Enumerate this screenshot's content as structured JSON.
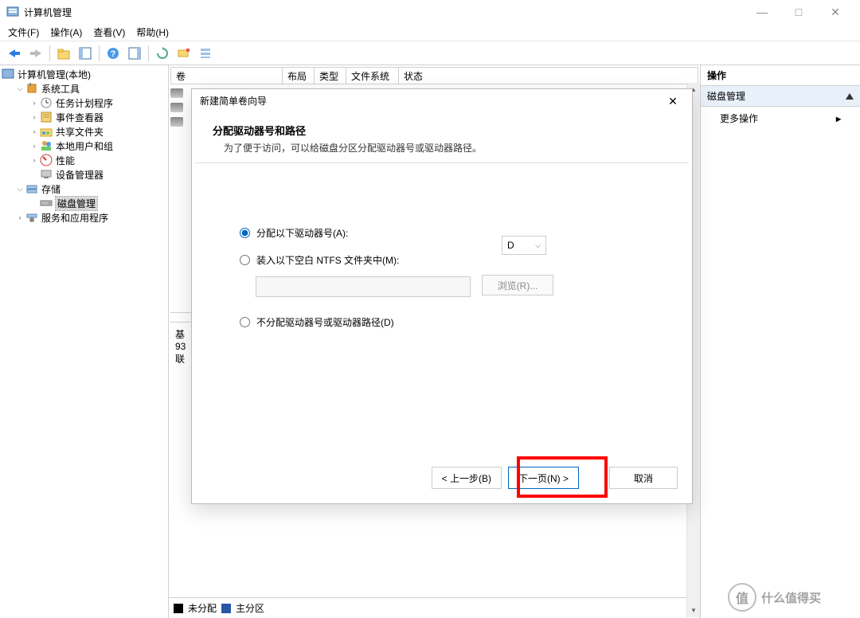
{
  "window": {
    "title": "计算机管理"
  },
  "win_controls": {
    "min": "—",
    "max": "□",
    "close": "✕"
  },
  "menu": {
    "file": "文件(F)",
    "action": "操作(A)",
    "view": "查看(V)",
    "help": "帮助(H)"
  },
  "tree": {
    "root": "计算机管理(本地)",
    "system_tools": "系统工具",
    "task_scheduler": "任务计划程序",
    "event_viewer": "事件查看器",
    "shared_folders": "共享文件夹",
    "local_users": "本地用户和组",
    "performance": "性能",
    "device_manager": "设备管理器",
    "storage": "存储",
    "disk_management": "磁盘管理",
    "services_apps": "服务和应用程序"
  },
  "vol_headers": {
    "volume": "卷",
    "layout": "布局",
    "type": "类型",
    "filesystem": "文件系统",
    "status": "状态"
  },
  "disk_block": {
    "line1": "基",
    "line2": "93",
    "line3": "联"
  },
  "legend": {
    "unallocated": "未分配",
    "primary": "主分区"
  },
  "actions_panel": {
    "header": "操作",
    "disk_mgmt": "磁盘管理",
    "more": "更多操作"
  },
  "dialog": {
    "title": "新建简单卷向导",
    "heading": "分配驱动器号和路径",
    "subtext": "为了便于访问，可以给磁盘分区分配驱动器号或驱动器路径。",
    "opt_assign": "分配以下驱动器号(A):",
    "drive_letter": "D",
    "opt_mount": "装入以下空白 NTFS 文件夹中(M):",
    "browse": "浏览(R)...",
    "opt_none": "不分配驱动器号或驱动器路径(D)",
    "back": "< 上一步(B)",
    "next": "下一页(N) >",
    "cancel": "取消"
  },
  "watermark": {
    "char": "值",
    "text": "什么值得买"
  }
}
